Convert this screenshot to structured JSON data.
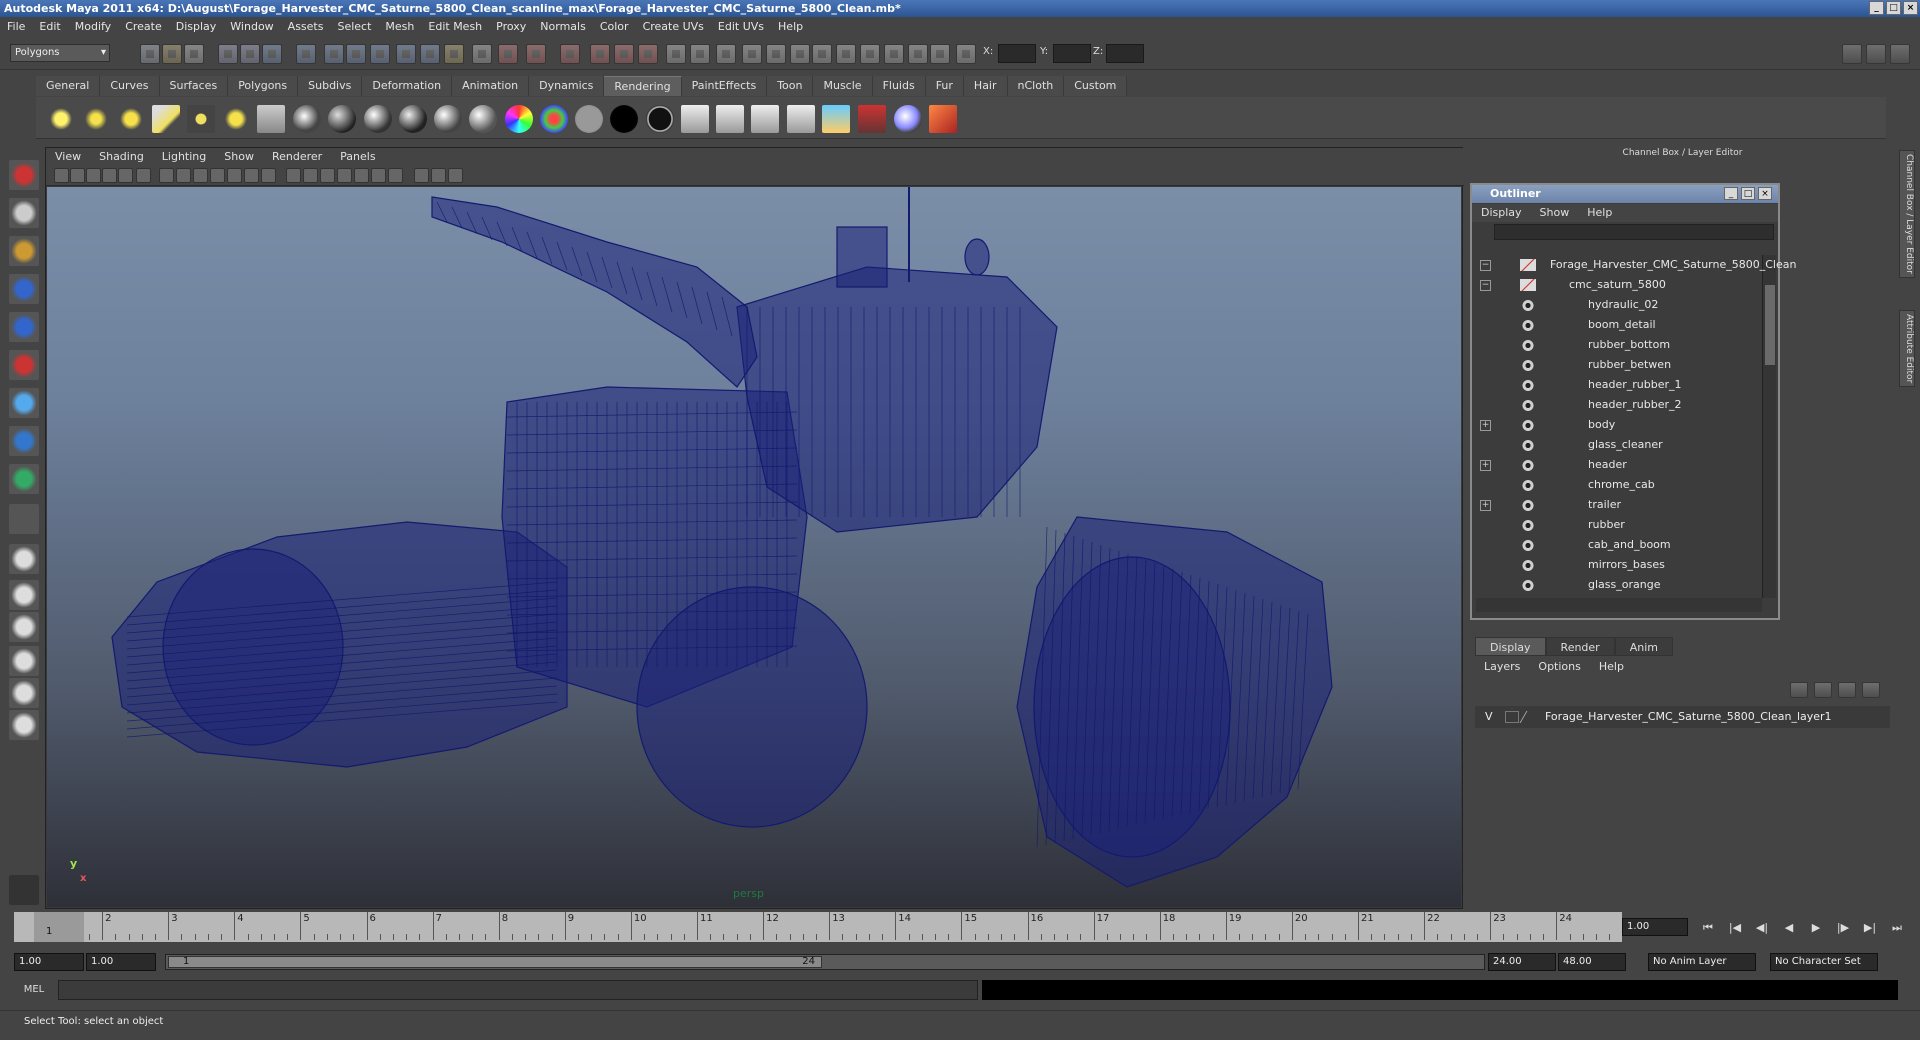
{
  "window": {
    "title": "Autodesk Maya 2011 x64: D:\\August\\Forage_Harvester_CMC_Saturne_5800_Clean_scanline_max\\Forage_Harvester_CMC_Saturne_5800_Clean.mb*"
  },
  "menubar": [
    "File",
    "Edit",
    "Modify",
    "Create",
    "Display",
    "Window",
    "Assets",
    "Select",
    "Mesh",
    "Edit Mesh",
    "Proxy",
    "Normals",
    "Color",
    "Create UVs",
    "Edit UVs",
    "Help"
  ],
  "statusline": {
    "menuset": "Polygons",
    "x_label": "X:",
    "y_label": "Y:",
    "z_label": "Z:"
  },
  "shelf_tabs": [
    "General",
    "Curves",
    "Surfaces",
    "Polygons",
    "Subdivs",
    "Deformation",
    "Animation",
    "Dynamics",
    "Rendering",
    "PaintEffects",
    "Toon",
    "Muscle",
    "Fluids",
    "Fur",
    "Hair",
    "nCloth",
    "Custom"
  ],
  "active_shelf": "Rendering",
  "viewport": {
    "menus": [
      "View",
      "Shading",
      "Lighting",
      "Show",
      "Renderer",
      "Panels"
    ],
    "camera_label": "persp",
    "axis_y": "y",
    "axis_x": "x"
  },
  "channelbox": {
    "title": "Channel Box / Layer Editor"
  },
  "outliner": {
    "title": "Outliner",
    "menus": [
      "Display",
      "Show",
      "Help"
    ],
    "items": [
      {
        "label": "Forage_Harvester_CMC_Saturne_5800_Clean",
        "indent": 0,
        "expander": "−"
      },
      {
        "label": "cmc_saturn_5800",
        "indent": 1,
        "expander": "−"
      },
      {
        "label": "hydraulic_02",
        "indent": 2,
        "expander": ""
      },
      {
        "label": "boom_detail",
        "indent": 2,
        "expander": ""
      },
      {
        "label": "rubber_bottom",
        "indent": 2,
        "expander": ""
      },
      {
        "label": "rubber_betwen",
        "indent": 2,
        "expander": ""
      },
      {
        "label": "header_rubber_1",
        "indent": 2,
        "expander": ""
      },
      {
        "label": "header_rubber_2",
        "indent": 2,
        "expander": ""
      },
      {
        "label": "body",
        "indent": 2,
        "expander": "+"
      },
      {
        "label": "glass_cleaner",
        "indent": 2,
        "expander": ""
      },
      {
        "label": "header",
        "indent": 2,
        "expander": "+"
      },
      {
        "label": "chrome_cab",
        "indent": 2,
        "expander": ""
      },
      {
        "label": "trailer",
        "indent": 2,
        "expander": "+"
      },
      {
        "label": "rubber",
        "indent": 2,
        "expander": ""
      },
      {
        "label": "cab_and_boom",
        "indent": 2,
        "expander": ""
      },
      {
        "label": "mirrors_bases",
        "indent": 2,
        "expander": ""
      },
      {
        "label": "glass_orange",
        "indent": 2,
        "expander": ""
      }
    ]
  },
  "layers": {
    "tabs": [
      "Display",
      "Render",
      "Anim"
    ],
    "active_tab": "Display",
    "menus": [
      "Layers",
      "Options",
      "Help"
    ],
    "visibility": "V",
    "layer_name": "Forage_Harvester_CMC_Saturne_5800_Clean_layer1"
  },
  "side_tabs": [
    "Channel Box / Layer Editor",
    "Attribute Editor"
  ],
  "timeline": {
    "ticks": [
      "1",
      "2",
      "3",
      "4",
      "5",
      "6",
      "7",
      "8",
      "9",
      "10",
      "11",
      "12",
      "13",
      "14",
      "15",
      "16",
      "17",
      "18",
      "19",
      "20",
      "21",
      "22",
      "23",
      "24"
    ],
    "current_marker": "1",
    "current_frame": "1.00"
  },
  "range": {
    "start": "1.00",
    "playback_start": "1.00",
    "thumb_start": "1",
    "thumb_end": "24",
    "playback_end": "24.00",
    "end": "48.00",
    "anim_layer": "No Anim Layer",
    "character_set": "No Character Set"
  },
  "command": {
    "language": "MEL"
  },
  "help_line": "Select Tool: select an object"
}
